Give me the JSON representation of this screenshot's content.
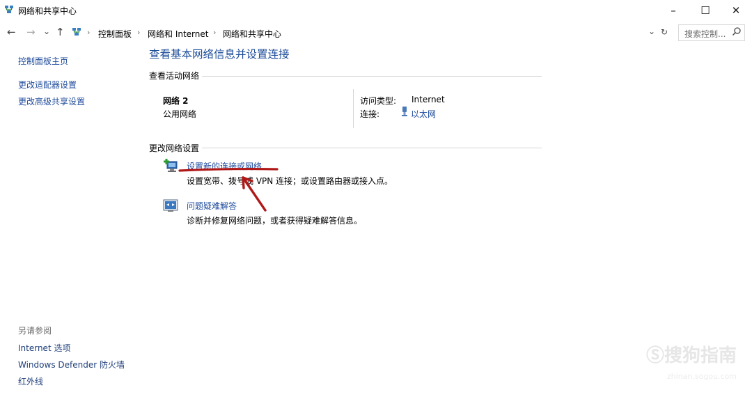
{
  "window": {
    "title": "网络和共享中心",
    "controls": {
      "minimize": "–",
      "maximize": "☐",
      "close": "✕"
    }
  },
  "address_bar": {
    "nav": {
      "back": "←",
      "forward": "→",
      "recent": "⌄",
      "up": "↑"
    },
    "breadcrumbs": [
      "控制面板",
      "网络和 Internet",
      "网络和共享中心"
    ],
    "separator": "›",
    "dropdown": "⌄",
    "refresh": "↻",
    "search_placeholder": "搜索控制..."
  },
  "sidebar": {
    "links": [
      "控制面板主页",
      "更改适配器设置",
      "更改高级共享设置"
    ],
    "see_also_heading": "另请参阅",
    "see_also": [
      "Internet 选项",
      "Windows Defender 防火墙",
      "红外线"
    ]
  },
  "main": {
    "title": "查看基本网络信息并设置连接",
    "active_networks": {
      "heading": "查看活动网络",
      "network_name": "网络 2",
      "network_type": "公用网络",
      "access_type_label": "访问类型:",
      "access_type_value": "Internet",
      "connection_label": "连接:",
      "connection_value": "以太网"
    },
    "change_settings": {
      "heading": "更改网络设置",
      "items": [
        {
          "link": "设置新的连接或网络",
          "desc": "设置宽带、拨号或 VPN 连接；或设置路由器或接入点。",
          "icon": "new-connection-icon"
        },
        {
          "link": "问题疑难解答",
          "desc": "诊断并修复网络问题，或者获得疑难解答信息。",
          "icon": "troubleshoot-icon"
        }
      ]
    }
  },
  "annotation": {
    "color": "#b01818"
  },
  "watermark": {
    "text": "Ⓢ搜狗指南",
    "sub": "zhinan.sogou.com"
  },
  "colors": {
    "link": "#1f4b9c",
    "title": "#1e4d9a"
  }
}
